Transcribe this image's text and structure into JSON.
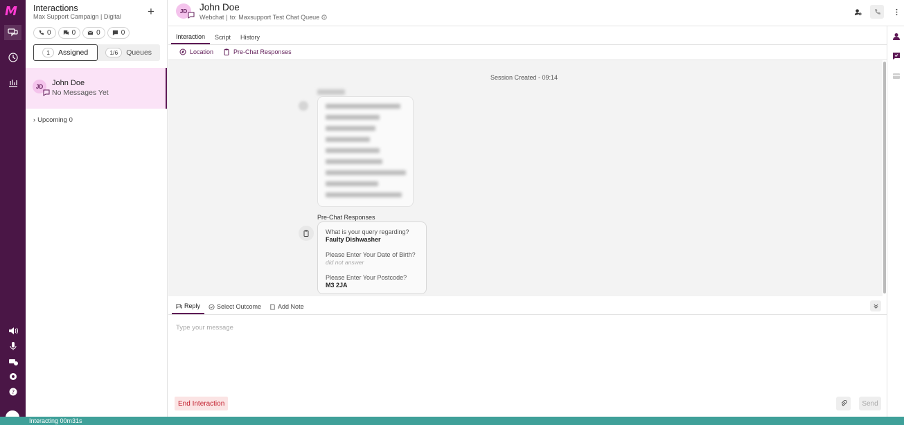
{
  "rail": {
    "logo": "M",
    "nav": [
      "interactions-icon",
      "history-icon",
      "reports-icon"
    ],
    "bottom": [
      "volume-icon",
      "microphone-icon",
      "headset-icon",
      "settings-icon",
      "help-icon"
    ]
  },
  "sidebar": {
    "title": "Interactions",
    "subtitle": "Max Support Campaign | Digital",
    "counts": [
      {
        "icon": "phone-icon",
        "value": "0"
      },
      {
        "icon": "chat-icon",
        "value": "0"
      },
      {
        "icon": "email-icon",
        "value": "0"
      },
      {
        "icon": "sms-icon",
        "value": "0"
      }
    ],
    "tabs": {
      "assigned_count": "1",
      "assigned_label": "Assigned",
      "queues_count": "1/6",
      "queues_label": "Queues"
    },
    "conversation": {
      "initials": "JD",
      "name": "John Doe",
      "preview": "No Messages Yet"
    },
    "upcoming": "Upcoming 0"
  },
  "header": {
    "initials": "JD",
    "name": "John Doe",
    "channel": "Webchat",
    "queue": "to: Maxsupport Test Chat Queue",
    "tabs": [
      "Interaction",
      "Script",
      "History"
    ],
    "subtabs": [
      "Location",
      "Pre-Chat Responses"
    ]
  },
  "chat": {
    "session": "Session Created - 09:14",
    "prechat_label": "Pre-Chat Responses",
    "prechat": [
      {
        "q": "What is your query regarding?",
        "a": "Faulty Dishwasher"
      },
      {
        "q": "Please Enter Your Date of Birth?",
        "a": "did not answer"
      },
      {
        "q": "Please Enter Your Postcode?",
        "a": "M3 2JA"
      }
    ]
  },
  "reply": {
    "tabs": [
      "Reply",
      "Select Outcome",
      "Add Note"
    ],
    "placeholder": "Type your message",
    "end_label": "End Interaction",
    "send_label": "Send"
  },
  "status": {
    "text": "Interacting 00m31s",
    "color": "#3fa099"
  },
  "colors": {
    "brand": "#4a1646",
    "accent": "#5e1a56",
    "highlight": "#fbe3f7",
    "danger": "#c21d2c"
  }
}
